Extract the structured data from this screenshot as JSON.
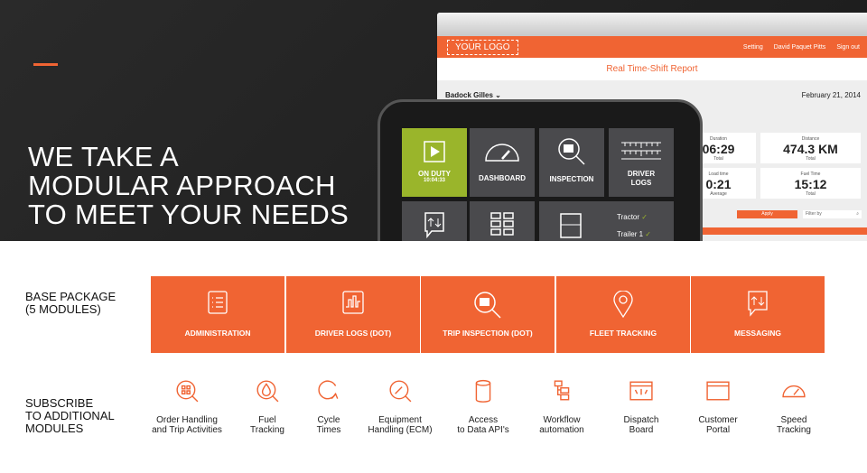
{
  "hero": {
    "headline": [
      "WE TAKE A",
      "MODULAR APPROACH",
      "TO MEET YOUR NEEDS"
    ],
    "accent": "#f06433"
  },
  "web": {
    "logo": "YOUR LOGO",
    "nav": [
      "Setting",
      "David Paquet Pitts",
      "Sign out"
    ],
    "title": "Real Time-Shift Report",
    "driver": "Badock Gilles",
    "date": "February 21, 2014",
    "cards": [
      {
        "label": "Duration",
        "value": "06:29",
        "sub": "Total"
      },
      {
        "label": "Distance",
        "value": "474.3 KM",
        "sub": "Total"
      },
      {
        "label": "Load time",
        "value": "0:21",
        "sub": "Average"
      },
      {
        "label": "Fuel Time",
        "value": "15:12",
        "sub": "Total"
      }
    ],
    "apply": "Apply",
    "filter_placeholder": "Filter by"
  },
  "tablet": {
    "tiles": [
      {
        "label": "ON DUTY",
        "sub": "10:04:33",
        "icon": "play-icon"
      },
      {
        "label": "DASHBOARD",
        "icon": "gauge-icon"
      },
      {
        "label": "INSPECTION",
        "icon": "truck-search-icon"
      },
      {
        "label": "DRIVER LOGS",
        "icon": "ruler-icon"
      }
    ],
    "status": [
      "Tractor",
      "Trailer 1"
    ],
    "on_duty_color": "#9ab52b"
  },
  "base": {
    "title": "BASE PACKAGE",
    "subtitle": "(5 MODULES)",
    "modules": [
      {
        "label": "ADMINISTRATION",
        "icon": "list-icon"
      },
      {
        "label": "DRIVER LOGS (DOT)",
        "icon": "chart-icon"
      },
      {
        "label": "TRIP INSPECTION (DOT)",
        "icon": "truck-search-icon"
      },
      {
        "label": "FLEET TRACKING",
        "icon": "map-pin-icon"
      },
      {
        "label": "MESSAGING",
        "icon": "message-icon"
      }
    ]
  },
  "subscribe": {
    "title": [
      "SUBSCRIBE",
      "TO ADDITIONAL",
      "MODULES"
    ],
    "modules": [
      {
        "l1": "Order Handling",
        "l2": "and Trip Activities"
      },
      {
        "l1": "Fuel",
        "l2": "Tracking"
      },
      {
        "l1": "Cycle",
        "l2": "Times"
      },
      {
        "l1": "Equipment",
        "l2": "Handling (ECM)"
      },
      {
        "l1": "Access",
        "l2": "to Data API's"
      },
      {
        "l1": "Workflow",
        "l2": "automation"
      },
      {
        "l1": "Dispatch",
        "l2": "Board"
      },
      {
        "l1": "Customer",
        "l2": "Portal"
      },
      {
        "l1": "Speed",
        "l2": "Tracking"
      }
    ]
  }
}
